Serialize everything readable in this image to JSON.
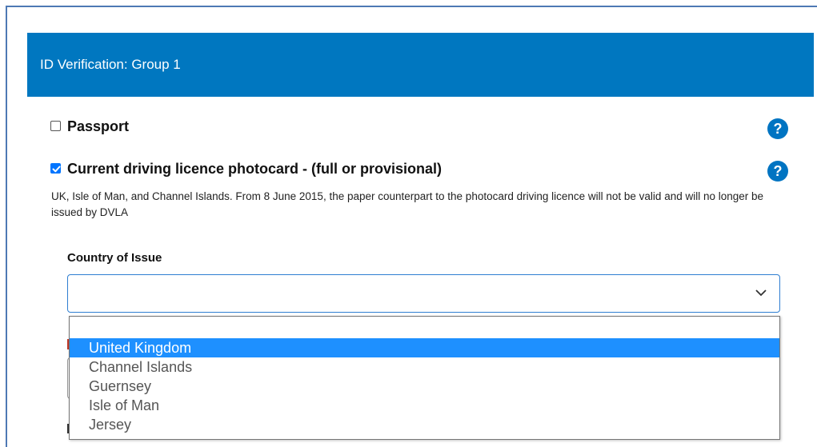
{
  "panel": {
    "title": "ID Verification: Group 1"
  },
  "options": [
    {
      "label": "Passport",
      "checked": false
    },
    {
      "label": "Current driving licence photocard - (full or provisional)",
      "checked": true
    }
  ],
  "help_icon_glyph": "?",
  "licence": {
    "description": "UK, Isle of Man, and Channel Islands. From 8 June 2015, the paper counterpart to the photocard driving licence will not be valid and will no longer be issued by DVLA",
    "country_label": "Country of Issue",
    "country_value": "",
    "country_options": [
      {
        "label": "United Kingdom",
        "selected": true
      },
      {
        "label": "Channel Islands",
        "selected": false
      },
      {
        "label": "Guernsey",
        "selected": false
      },
      {
        "label": "Isle of Man",
        "selected": false
      },
      {
        "label": "Jersey",
        "selected": false
      }
    ]
  },
  "colors": {
    "header_bg": "#0077c0",
    "help_icon": "#0074c2",
    "checkbox_checked": "#0075ff",
    "dropdown_selected": "#1e90ff",
    "frame_border": "#4e79b4"
  },
  "icons": {
    "help": "question-circle-icon",
    "select": "chevron-down-icon",
    "check": "check-icon"
  }
}
